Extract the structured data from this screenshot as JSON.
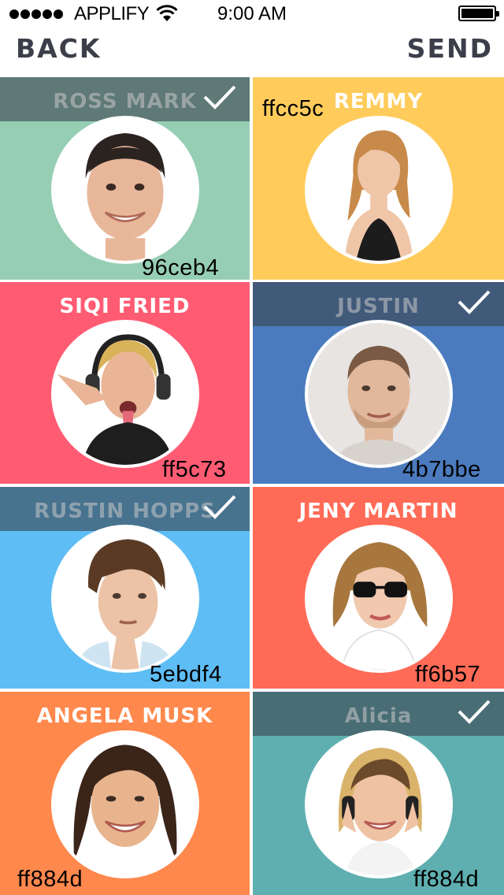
{
  "status_bar": {
    "carrier": "APPLIFY",
    "time": "9:00 AM"
  },
  "nav": {
    "back_label": "BACK",
    "send_label": "SEND"
  },
  "contacts": [
    {
      "name": "ROSS MARK",
      "color": "#96ceb4",
      "hex_label": "96ceb4",
      "selected": true,
      "avatar_icon": "avatar-man-smiling"
    },
    {
      "name": "REMMY",
      "color": "#ffcc5c",
      "hex_label": "ffcc5c",
      "selected": false,
      "avatar_icon": "avatar-woman-blonde"
    },
    {
      "name": "SIQI FRIED",
      "color": "#ff5c73",
      "hex_label": "ff5c73",
      "selected": false,
      "avatar_icon": "avatar-man-headphones"
    },
    {
      "name": "JUSTIN",
      "color": "#4b7bbe",
      "hex_label": "4b7bbe",
      "selected": true,
      "avatar_icon": "avatar-man-short-hair"
    },
    {
      "name": "RUSTIN HOPPS",
      "color": "#5ebdf4",
      "hex_label": "5ebdf4",
      "selected": true,
      "avatar_icon": "avatar-man-thinking"
    },
    {
      "name": "JENY MARTIN",
      "color": "#ff6b57",
      "hex_label": "ff6b57",
      "selected": false,
      "avatar_icon": "avatar-woman-sunglasses"
    },
    {
      "name": "ANGELA MUSK",
      "color": "#ff884d",
      "hex_label": "ff884d",
      "selected": false,
      "avatar_icon": "avatar-woman-smiling"
    },
    {
      "name": "Alicia",
      "color": "#5fafb0",
      "hex_label": "ff884d",
      "selected": true,
      "avatar_icon": "avatar-woman-headphones"
    }
  ]
}
